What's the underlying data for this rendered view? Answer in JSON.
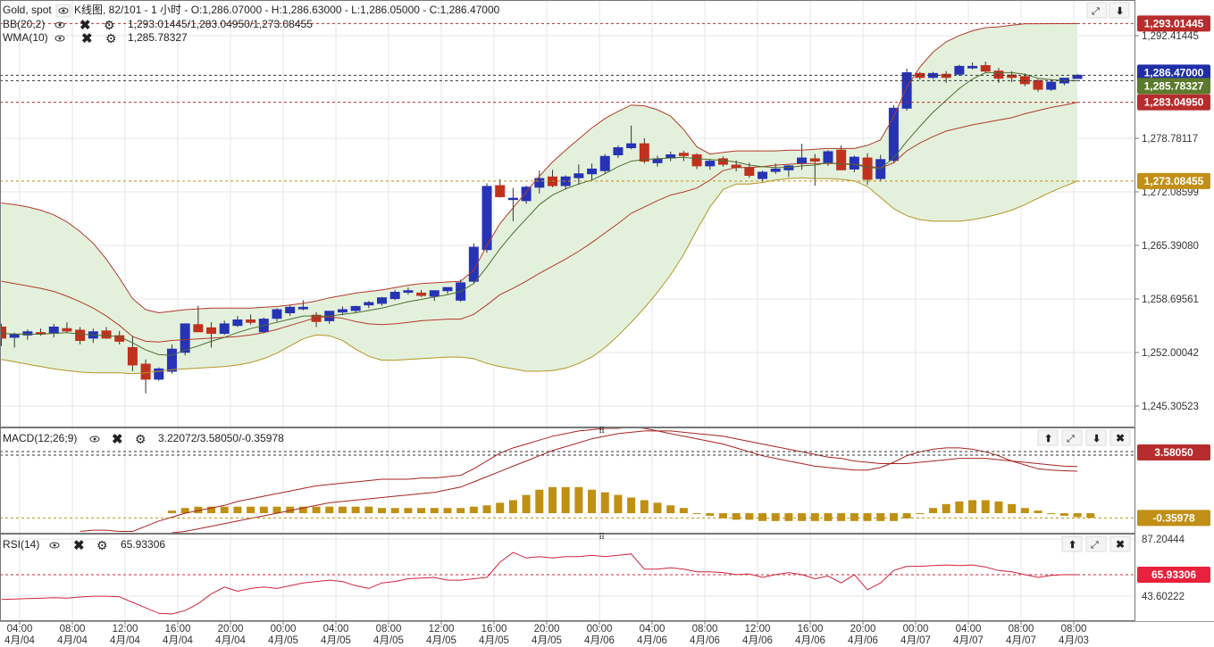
{
  "header": {
    "symbol": "Gold, spot",
    "info": "K线图, 82/101 - 1 小时 - O:1,286.07000 - H:1,286.63000 - L:1,286.05000 - C:1,286.47000",
    "bb_label": "BB(20,2)",
    "bb_values": "1,293.01445/1,283.04950/1,273.08455",
    "wma_label": "WMA(10)",
    "wma_value": "1,285.78327",
    "macd_label": "MACD(12;26;9)",
    "macd_values": "3.22072/3.58050/-0.35978",
    "rsi_label": "RSI(14)",
    "rsi_value": "65.93306"
  },
  "colors": {
    "bull": "#2633b5",
    "bear": "#c0311e",
    "bb_fill": "#e3f1dc",
    "bb_upper": "#b23a2a",
    "bb_lower": "#b39424",
    "bb_mid": "#b23a2a",
    "wma": "#4d6b30",
    "macd_hist": "#bf9012",
    "macd_line": "#a82222",
    "rsi_line": "#d0233c",
    "tag_bb_upper": "#b72c2c",
    "tag_price": "#1f2fa8",
    "tag_wma": "#5b7a2b",
    "tag_bb_mid": "#b72c2c",
    "tag_bb_lower": "#c18f15"
  },
  "price_axis": {
    "ticks": [
      "1,292.41445",
      "1,278.78117",
      "1,272.08599",
      "1,265.39080",
      "1,258.69561",
      "1,252.00042",
      "1,245.30523"
    ],
    "tags": {
      "bb_upper": "1,293.01445",
      "price": "1,286.47000",
      "wma": "1,285.78327",
      "bb_mid": "1,283.04950",
      "bb_lower": "1,273.08455"
    }
  },
  "macd_axis": {
    "tags": {
      "signal": "3.58050",
      "hist": "-0.35978"
    }
  },
  "rsi_axis": {
    "ticks": [
      "87.20444",
      "43.60222"
    ],
    "tag": "65.93306"
  },
  "time_axis": [
    {
      "t": "04:00",
      "d": "4月/04"
    },
    {
      "t": "08:00",
      "d": "4月/04"
    },
    {
      "t": "12:00",
      "d": "4月/04"
    },
    {
      "t": "16:00",
      "d": "4月/04"
    },
    {
      "t": "20:00",
      "d": "4月/04"
    },
    {
      "t": "00:00",
      "d": "4月/05"
    },
    {
      "t": "04:00",
      "d": "4月/05"
    },
    {
      "t": "08:00",
      "d": "4月/05"
    },
    {
      "t": "12:00",
      "d": "4月/05"
    },
    {
      "t": "16:00",
      "d": "4月/05"
    },
    {
      "t": "20:00",
      "d": "4月/05"
    },
    {
      "t": "00:00",
      "d": "4月/06"
    },
    {
      "t": "04:00",
      "d": "4月/06"
    },
    {
      "t": "08:00",
      "d": "4月/06"
    },
    {
      "t": "12:00",
      "d": "4月/06"
    },
    {
      "t": "16:00",
      "d": "4月/06"
    },
    {
      "t": "20:00",
      "d": "4月/06"
    },
    {
      "t": "00:00",
      "d": "4月/07"
    },
    {
      "t": "04:00",
      "d": "4月/07"
    },
    {
      "t": "08:00",
      "d": "4月/07"
    },
    {
      "t": "08:00",
      "d": "4月/03"
    }
  ],
  "chart_data": {
    "type": "candlestick",
    "price_range": [
      1242.0,
      1296.0
    ],
    "ohlc": [
      [
        1254.6,
        1255.0,
        1252.2,
        1253.2
      ],
      [
        1253.3,
        1253.9,
        1252.0,
        1253.7
      ],
      [
        1253.6,
        1254.3,
        1253.0,
        1254.0
      ],
      [
        1253.9,
        1254.4,
        1253.5,
        1253.7
      ],
      [
        1253.8,
        1255.0,
        1253.3,
        1254.6
      ],
      [
        1254.4,
        1255.2,
        1253.9,
        1254.1
      ],
      [
        1254.2,
        1254.6,
        1252.4,
        1252.9
      ],
      [
        1253.2,
        1254.4,
        1252.6,
        1254.0
      ],
      [
        1254.1,
        1254.6,
        1253.1,
        1253.2
      ],
      [
        1253.5,
        1254.1,
        1252.4,
        1252.8
      ],
      [
        1252.0,
        1253.5,
        1249.0,
        1249.8
      ],
      [
        1249.9,
        1250.5,
        1246.2,
        1248.0
      ],
      [
        1248.0,
        1249.5,
        1247.8,
        1249.3
      ],
      [
        1249.0,
        1252.4,
        1248.7,
        1251.8
      ],
      [
        1251.4,
        1255.0,
        1251.0,
        1255.0
      ],
      [
        1254.9,
        1257.3,
        1254.0,
        1254.0
      ],
      [
        1254.5,
        1255.2,
        1252.0,
        1253.8
      ],
      [
        1253.8,
        1255.4,
        1253.6,
        1255.0
      ],
      [
        1254.8,
        1256.0,
        1254.6,
        1255.5
      ],
      [
        1255.5,
        1256.2,
        1254.9,
        1255.2
      ],
      [
        1254.0,
        1255.8,
        1253.8,
        1255.6
      ],
      [
        1255.7,
        1257.0,
        1255.3,
        1256.8
      ],
      [
        1256.4,
        1257.4,
        1256.0,
        1257.1
      ],
      [
        1256.9,
        1258.0,
        1256.7,
        1257.1
      ],
      [
        1256.1,
        1256.5,
        1254.6,
        1255.3
      ],
      [
        1255.4,
        1256.5,
        1255.0,
        1256.6
      ],
      [
        1256.5,
        1257.2,
        1256.1,
        1256.8
      ],
      [
        1256.7,
        1257.3,
        1256.4,
        1257.2
      ],
      [
        1257.4,
        1257.9,
        1257.0,
        1257.7
      ],
      [
        1257.6,
        1258.4,
        1257.3,
        1258.3
      ],
      [
        1258.2,
        1259.3,
        1258.0,
        1259.0
      ],
      [
        1259.0,
        1259.6,
        1258.7,
        1259.2
      ],
      [
        1258.9,
        1259.3,
        1258.4,
        1258.6
      ],
      [
        1258.5,
        1259.1,
        1257.9,
        1259.2
      ],
      [
        1259.2,
        1259.6,
        1258.8,
        1259.6
      ],
      [
        1258.0,
        1260.6,
        1257.8,
        1260.2
      ],
      [
        1260.4,
        1265.2,
        1260.2,
        1264.7
      ],
      [
        1264.4,
        1272.8,
        1264.0,
        1272.4
      ],
      [
        1272.5,
        1273.3,
        1271.0,
        1271.1
      ],
      [
        1270.9,
        1272.2,
        1268.0,
        1270.9
      ],
      [
        1270.6,
        1272.5,
        1270.2,
        1272.3
      ],
      [
        1272.3,
        1274.4,
        1271.5,
        1273.4
      ],
      [
        1273.6,
        1274.5,
        1272.3,
        1272.5
      ],
      [
        1272.5,
        1273.8,
        1272.0,
        1273.6
      ],
      [
        1273.5,
        1275.2,
        1272.6,
        1274.0
      ],
      [
        1274.0,
        1275.3,
        1273.2,
        1274.6
      ],
      [
        1274.4,
        1276.5,
        1274.0,
        1276.2
      ],
      [
        1276.4,
        1277.6,
        1276.0,
        1277.3
      ],
      [
        1277.3,
        1280.1,
        1277.1,
        1277.8
      ],
      [
        1277.8,
        1278.5,
        1275.3,
        1275.6
      ],
      [
        1275.4,
        1276.3,
        1274.9,
        1275.9
      ],
      [
        1276.0,
        1276.8,
        1275.6,
        1276.4
      ],
      [
        1276.6,
        1276.9,
        1275.6,
        1276.3
      ],
      [
        1276.4,
        1276.6,
        1274.6,
        1275.0
      ],
      [
        1275.0,
        1275.9,
        1274.5,
        1275.6
      ],
      [
        1275.9,
        1276.2,
        1274.9,
        1275.2
      ],
      [
        1275.1,
        1275.7,
        1274.3,
        1274.8
      ],
      [
        1274.8,
        1275.4,
        1273.5,
        1273.8
      ],
      [
        1273.4,
        1274.4,
        1273.0,
        1274.2
      ],
      [
        1274.3,
        1275.3,
        1274.0,
        1274.6
      ],
      [
        1274.5,
        1275.1,
        1273.6,
        1275.0
      ],
      [
        1275.3,
        1277.8,
        1274.5,
        1276.0
      ],
      [
        1275.9,
        1276.5,
        1272.5,
        1275.6
      ],
      [
        1275.4,
        1277.0,
        1275.0,
        1276.8
      ],
      [
        1277.0,
        1277.6,
        1274.5,
        1274.5
      ],
      [
        1274.6,
        1276.3,
        1274.2,
        1276.1
      ],
      [
        1276.0,
        1276.6,
        1272.6,
        1273.3
      ],
      [
        1273.4,
        1276.4,
        1273.0,
        1275.8
      ],
      [
        1275.7,
        1282.7,
        1275.3,
        1282.3
      ],
      [
        1282.3,
        1287.3,
        1282.0,
        1286.8
      ],
      [
        1286.7,
        1286.9,
        1285.9,
        1286.2
      ],
      [
        1286.2,
        1286.9,
        1286.0,
        1286.7
      ],
      [
        1286.6,
        1287.0,
        1285.5,
        1286.2
      ],
      [
        1286.6,
        1287.8,
        1286.4,
        1287.6
      ],
      [
        1287.4,
        1288.1,
        1287.2,
        1287.6
      ],
      [
        1287.7,
        1288.2,
        1286.8,
        1287.0
      ],
      [
        1287.0,
        1287.4,
        1285.5,
        1286.1
      ],
      [
        1286.5,
        1287.0,
        1285.6,
        1286.2
      ],
      [
        1286.3,
        1286.7,
        1285.1,
        1285.4
      ],
      [
        1285.8,
        1286.0,
        1284.4,
        1284.7
      ],
      [
        1284.7,
        1286.0,
        1284.5,
        1285.6
      ],
      [
        1285.5,
        1286.1,
        1285.2,
        1286.1
      ],
      [
        1286.07,
        1286.63,
        1286.05,
        1286.47
      ]
    ],
    "bb_upper": [
      1270.3,
      1270.1,
      1269.8,
      1269.4,
      1268.8,
      1267.9,
      1266.7,
      1265.2,
      1263.2,
      1260.8,
      1258.2,
      1256.8,
      1256.4,
      1256.6,
      1256.8,
      1256.9,
      1257.0,
      1257.0,
      1257.0,
      1257.0,
      1257.1,
      1257.2,
      1257.4,
      1257.6,
      1257.9,
      1258.3,
      1258.6,
      1258.9,
      1259.1,
      1259.3,
      1259.6,
      1259.9,
      1260.1,
      1260.2,
      1260.3,
      1260.4,
      1261.8,
      1264.9,
      1267.7,
      1269.7,
      1271.7,
      1273.7,
      1275.5,
      1277.0,
      1278.4,
      1279.8,
      1281.0,
      1281.9,
      1282.7,
      1282.6,
      1282.1,
      1281.3,
      1279.6,
      1277.4,
      1276.5,
      1276.7,
      1276.9,
      1276.9,
      1276.9,
      1276.9,
      1277.0,
      1277.0,
      1277.1,
      1277.2,
      1277.2,
      1277.2,
      1277.6,
      1278.3,
      1281.2,
      1285.0,
      1287.5,
      1289.4,
      1290.7,
      1291.5,
      1292.1,
      1292.5,
      1292.6,
      1292.8,
      1293.0,
      1293.0,
      1293.01,
      1293.01,
      1293.01
    ],
    "bb_lower": [
      1250.5,
      1250.2,
      1249.9,
      1249.6,
      1249.3,
      1249.1,
      1248.9,
      1248.8,
      1248.8,
      1248.8,
      1248.7,
      1248.8,
      1249.0,
      1249.2,
      1249.3,
      1249.4,
      1249.5,
      1249.6,
      1249.8,
      1250.1,
      1250.6,
      1251.3,
      1252.2,
      1253.1,
      1253.6,
      1253.5,
      1252.9,
      1251.8,
      1250.9,
      1250.4,
      1250.4,
      1250.5,
      1250.6,
      1250.7,
      1250.8,
      1250.8,
      1250.6,
      1250.0,
      1249.6,
      1249.3,
      1249.0,
      1249.0,
      1249.1,
      1249.4,
      1250.0,
      1250.8,
      1252.0,
      1253.5,
      1255.2,
      1257.0,
      1259.0,
      1261.2,
      1263.8,
      1266.9,
      1269.8,
      1272.0,
      1272.7,
      1272.7,
      1272.9,
      1273.2,
      1273.4,
      1273.5,
      1273.4,
      1273.4,
      1273.3,
      1273.1,
      1272.4,
      1271.0,
      1269.6,
      1268.7,
      1268.2,
      1268.0,
      1268.0,
      1268.0,
      1268.2,
      1268.5,
      1268.9,
      1269.4,
      1270.1,
      1270.9,
      1271.7,
      1272.4,
      1273.08
    ],
    "bb_mid": [
      1260.4,
      1260.1,
      1259.8,
      1259.5,
      1259.1,
      1258.5,
      1257.8,
      1257.0,
      1256.0,
      1254.8,
      1253.4,
      1252.8,
      1252.7,
      1252.9,
      1253.0,
      1253.1,
      1253.2,
      1253.3,
      1253.4,
      1253.6,
      1253.9,
      1254.3,
      1254.8,
      1255.3,
      1255.8,
      1255.9,
      1255.7,
      1255.3,
      1255.0,
      1254.9,
      1255.0,
      1255.2,
      1255.4,
      1255.5,
      1255.6,
      1255.6,
      1256.2,
      1257.4,
      1258.7,
      1259.5,
      1260.4,
      1261.4,
      1262.3,
      1263.2,
      1264.2,
      1265.3,
      1266.5,
      1267.7,
      1269.0,
      1269.8,
      1270.6,
      1271.3,
      1271.7,
      1272.2,
      1273.2,
      1274.4,
      1274.8,
      1274.8,
      1274.9,
      1275.1,
      1275.2,
      1275.3,
      1275.3,
      1275.3,
      1275.3,
      1275.2,
      1275.0,
      1274.7,
      1275.4,
      1276.9,
      1277.9,
      1278.7,
      1279.4,
      1279.8,
      1280.2,
      1280.5,
      1280.8,
      1281.1,
      1281.6,
      1282.0,
      1282.4,
      1282.7,
      1283.05
    ],
    "wma": [
      1253.8,
      1253.7,
      1253.7,
      1253.7,
      1253.8,
      1253.9,
      1253.7,
      1253.6,
      1253.5,
      1253.4,
      1252.6,
      1251.7,
      1251.1,
      1251.0,
      1251.7,
      1252.2,
      1252.8,
      1253.3,
      1253.9,
      1254.4,
      1254.8,
      1255.2,
      1255.6,
      1256.0,
      1256.0,
      1256.0,
      1256.2,
      1256.4,
      1256.7,
      1257.0,
      1257.4,
      1257.8,
      1258.1,
      1258.4,
      1258.7,
      1259.1,
      1260.1,
      1262.2,
      1264.5,
      1266.5,
      1268.3,
      1270.1,
      1271.3,
      1272.1,
      1272.7,
      1273.2,
      1274.0,
      1274.9,
      1275.6,
      1275.8,
      1275.9,
      1276.0,
      1276.1,
      1275.9,
      1275.8,
      1275.7,
      1275.5,
      1275.1,
      1274.9,
      1274.8,
      1274.8,
      1275.0,
      1275.1,
      1275.4,
      1275.2,
      1275.2,
      1274.8,
      1274.7,
      1276.0,
      1278.1,
      1280.0,
      1281.8,
      1283.3,
      1284.8,
      1286.0,
      1286.8,
      1286.8,
      1286.8,
      1286.6,
      1286.1,
      1285.9,
      1285.8,
      1285.78
    ],
    "macd": {
      "range": [
        -1.5,
        6.5
      ],
      "hist_start": 13,
      "hist": [
        0.2,
        0.4,
        0.5,
        0.5,
        0.5,
        0.5,
        0.5,
        0.5,
        0.5,
        0.5,
        0.5,
        0.5,
        0.5,
        0.5,
        0.5,
        0.5,
        0.4,
        0.4,
        0.4,
        0.4,
        0.4,
        0.4,
        0.4,
        0.5,
        0.6,
        0.8,
        1.0,
        1.4,
        1.8,
        2.0,
        2.0,
        2.0,
        1.8,
        1.6,
        1.4,
        1.2,
        1.0,
        0.8,
        0.6,
        0.4,
        0.0,
        -0.2,
        -0.4,
        -0.5,
        -0.5,
        -0.6,
        -0.6,
        -0.6,
        -0.6,
        -0.6,
        -0.6,
        -0.6,
        -0.6,
        -0.6,
        -0.6,
        -0.6,
        -0.4,
        0.0,
        0.4,
        0.7,
        0.9,
        1.0,
        1.0,
        0.9,
        0.7,
        0.4,
        0.2,
        0.0,
        -0.2,
        -0.3,
        -0.36
      ],
      "macd_line": [
        -2.2,
        -2.2,
        -2.0,
        -1.8,
        -1.6,
        -1.5,
        -1.4,
        -1.3,
        -1.3,
        -1.4,
        -1.4,
        -1.0,
        -0.6,
        -0.3,
        0.0,
        0.2,
        0.4,
        0.6,
        0.9,
        1.1,
        1.3,
        1.5,
        1.7,
        1.9,
        2.1,
        2.2,
        2.3,
        2.4,
        2.5,
        2.6,
        2.6,
        2.6,
        2.7,
        2.7,
        2.8,
        2.9,
        3.4,
        4.0,
        4.6,
        5.0,
        5.3,
        5.6,
        5.9,
        6.1,
        6.3,
        6.4,
        6.5,
        6.5,
        6.6,
        6.5,
        6.3,
        6.1,
        5.9,
        5.7,
        5.5,
        5.3,
        5.0,
        4.7,
        4.4,
        4.2,
        4.0,
        3.8,
        3.6,
        3.5,
        3.4,
        3.3,
        3.3,
        3.5,
        3.9,
        4.4,
        4.7,
        4.9,
        5.0,
        5.0,
        4.9,
        4.7,
        4.4,
        4.0,
        3.7,
        3.4,
        3.3,
        3.25,
        3.22
      ],
      "signal_line": [
        null,
        null,
        null,
        null,
        null,
        null,
        null,
        null,
        null,
        null,
        null,
        null,
        null,
        -1.5,
        -1.4,
        -1.2,
        -1.0,
        -0.8,
        -0.6,
        -0.4,
        -0.2,
        0.0,
        0.2,
        0.4,
        0.6,
        0.8,
        0.9,
        1.0,
        1.1,
        1.2,
        1.3,
        1.4,
        1.5,
        1.6,
        1.8,
        2.0,
        2.4,
        2.8,
        3.2,
        3.6,
        4.0,
        4.4,
        4.8,
        5.1,
        5.4,
        5.7,
        5.9,
        6.1,
        6.2,
        6.3,
        6.3,
        6.3,
        6.2,
        6.1,
        6.0,
        5.9,
        5.7,
        5.5,
        5.3,
        5.1,
        4.9,
        4.7,
        4.5,
        4.3,
        4.2,
        4.0,
        3.9,
        3.8,
        3.8,
        3.8,
        3.9,
        4.0,
        4.1,
        4.2,
        4.2,
        4.2,
        4.1,
        4.0,
        3.9,
        3.8,
        3.7,
        3.6,
        3.58
      ]
    },
    "rsi": {
      "range": [
        33,
        95
      ],
      "values": [
        48.0,
        48.4,
        48.6,
        48.9,
        49.3,
        49.0,
        49.8,
        50.4,
        50.4,
        50.0,
        45.9,
        42.0,
        38.0,
        37.5,
        40.0,
        45.0,
        52.0,
        57.0,
        54.0,
        56.0,
        57.0,
        56.0,
        58.0,
        60.0,
        61.0,
        62.0,
        61.0,
        58.0,
        56.0,
        60.0,
        61.0,
        63.0,
        63.5,
        64.0,
        62.0,
        62.0,
        63.0,
        64.0,
        75.0,
        82.0,
        78.0,
        79.0,
        78.0,
        79.0,
        79.0,
        80.0,
        79.0,
        80.0,
        81.0,
        70.0,
        70.0,
        71.0,
        70.0,
        68.0,
        68.0,
        67.5,
        66.0,
        66.5,
        64.0,
        66.0,
        67.5,
        66.0,
        63.0,
        65.0,
        60.0,
        66.0,
        55.0,
        60.0,
        69.0,
        72.0,
        72.0,
        72.5,
        73.0,
        72.5,
        73.0,
        71.5,
        69.0,
        68.0,
        66.0,
        64.0,
        65.5,
        66.0,
        65.93
      ]
    }
  }
}
